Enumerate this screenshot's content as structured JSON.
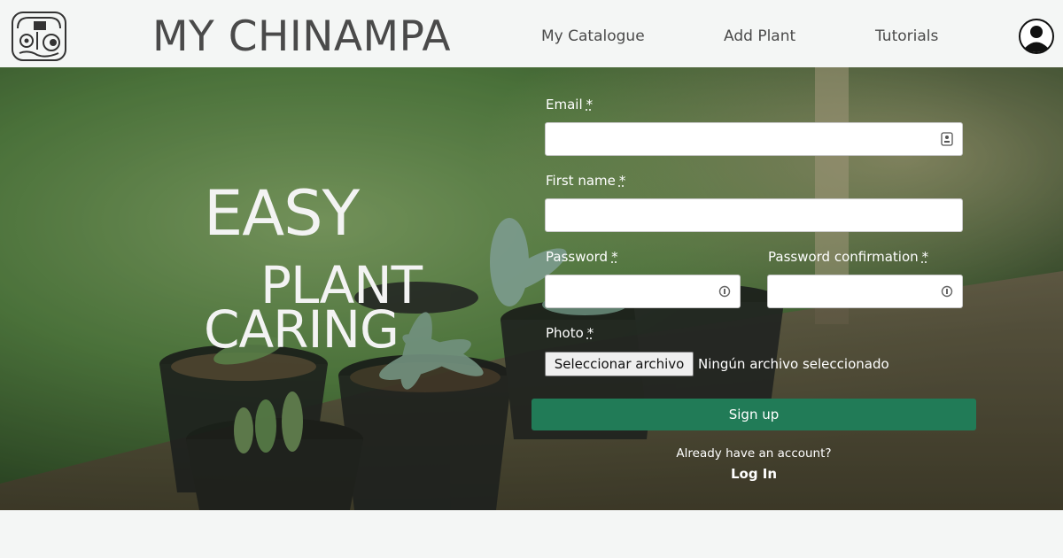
{
  "header": {
    "brand": "MY CHINAMPA",
    "nav": [
      {
        "label": "My Catalogue"
      },
      {
        "label": "Add Plant"
      },
      {
        "label": "Tutorials"
      }
    ],
    "logo_icon": "aztec-glyph-logo",
    "user_icon": "user-avatar-icon"
  },
  "hero": {
    "tagline": [
      "EASY",
      "PLANT",
      "CARING"
    ]
  },
  "form": {
    "email": {
      "label": "Email",
      "required_mark": "*",
      "value": ""
    },
    "first_name": {
      "label": "First name",
      "required_mark": "*",
      "value": ""
    },
    "password": {
      "label": "Password",
      "required_mark": "*",
      "value": ""
    },
    "password_confirmation": {
      "label": "Password confirmation",
      "required_mark": "*",
      "value": ""
    },
    "photo": {
      "label": "Photo",
      "required_mark": "*",
      "button_label": "Seleccionar archivo",
      "status": "Ningún archivo seleccionado"
    },
    "submit_label": "Sign up",
    "already_text": "Already have an account?",
    "login_label": "Log In"
  },
  "colors": {
    "primary": "#217b57",
    "header_bg": "#f4f6f5",
    "text_dark": "#4a4a4a"
  }
}
